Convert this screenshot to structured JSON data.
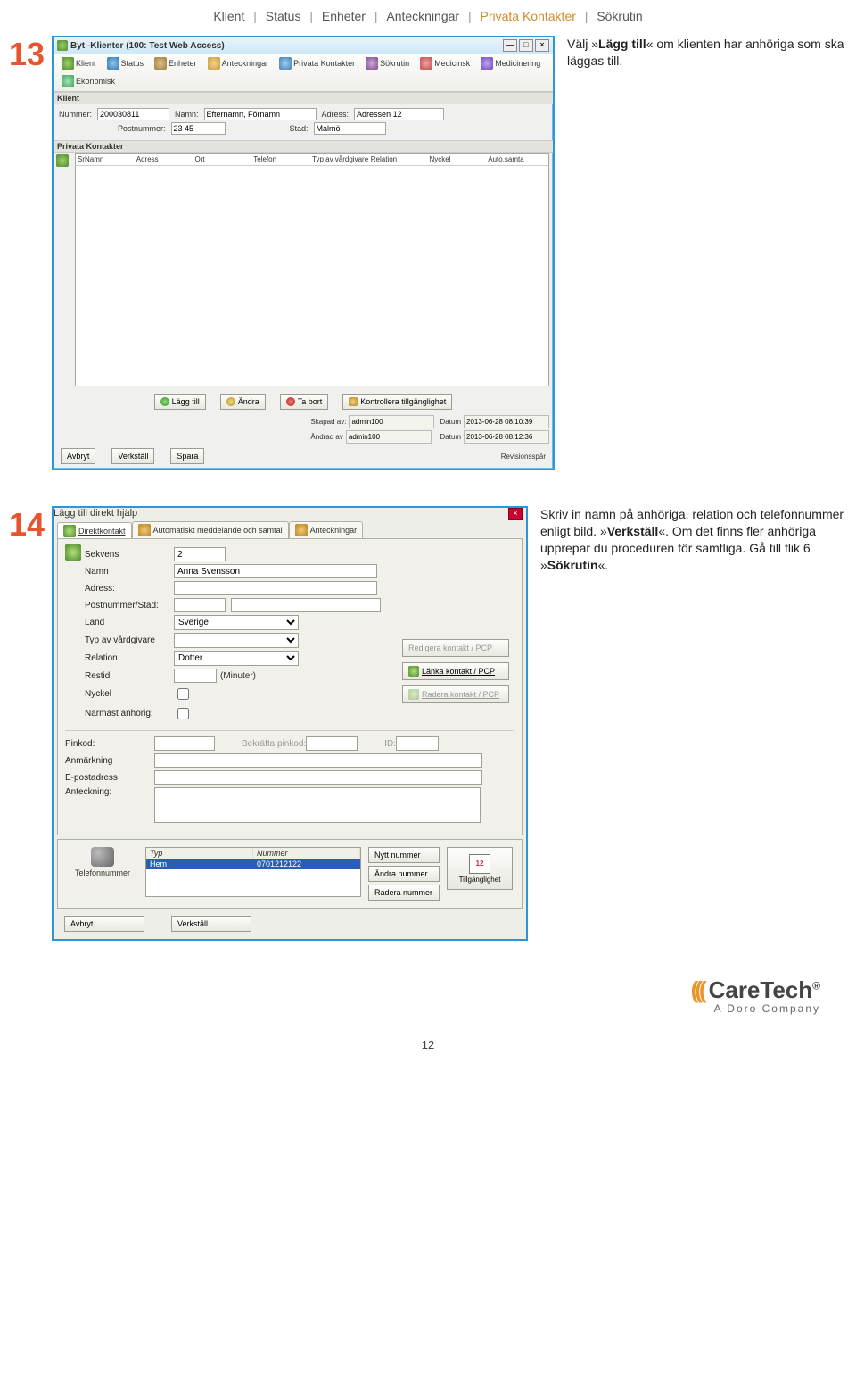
{
  "breadcrumb": {
    "items": [
      "Klient",
      "Status",
      "Enheter",
      "Anteckningar",
      "Privata Kontakter",
      "Sökrutin"
    ],
    "active_index": 4
  },
  "step13": {
    "number": "13",
    "window_title": "Byt -Klienter (100: Test Web Access)",
    "toolbar": [
      {
        "icon": "ico-user",
        "label": "Klient"
      },
      {
        "icon": "ico-blue",
        "label": "Status"
      },
      {
        "icon": "ico-box",
        "label": "Enheter"
      },
      {
        "icon": "ico-note",
        "label": "Anteckningar"
      },
      {
        "icon": "ico-person",
        "label": "Privata Kontakter"
      },
      {
        "icon": "ico-search",
        "label": "Sökrutin"
      },
      {
        "icon": "ico-med",
        "label": "Medicinsk"
      },
      {
        "icon": "ico-pill",
        "label": "Medicinering"
      },
      {
        "icon": "ico-econ",
        "label": "Ekonomisk"
      }
    ],
    "klient_header": "Klient",
    "klient": {
      "nummer_label": "Nummer:",
      "nummer": "200030811",
      "namn_label": "Namn:",
      "namn": "Efternamn, Förnamn",
      "adress_label": "Adress:",
      "adress": "Adressen 12",
      "postnr_label": "Postnummer:",
      "postnr": "23 45",
      "stad_label": "Stad:",
      "stad": "Malmö"
    },
    "pk_header": "Privata Kontakter",
    "pk_cols": [
      "SrNamn",
      "Adress",
      "Ort",
      "Telefon",
      "Typ av vårdgivare",
      "Relation",
      "Nyckel",
      "Auto.samta"
    ],
    "buttons": {
      "lagg_till": "Lägg till",
      "andra": "Ändra",
      "ta_bort": "Ta bort",
      "kontrollera": "Kontrollera tillgänglighet"
    },
    "meta": {
      "skapad_av_lbl": "Skapad av:",
      "skapad_av": "admin100",
      "skapad_datum_lbl": "Datum",
      "skapad_datum": "2013-06-28 08:10:39",
      "andrad_av_lbl": "Ändrad av",
      "andrad_av": "admin100",
      "andrad_datum_lbl": "Datum",
      "andrad_datum": "2013-06-28 08:12:36"
    },
    "bottom": {
      "avbryt": "Avbryt",
      "verkstall": "Verkställ",
      "spara": "Spara",
      "revision": "Revisionsspår"
    },
    "explanation_pre": "Välj »",
    "explanation_bold": "Lägg till",
    "explanation_post": "« om klienten har anhöriga som ska läggas till."
  },
  "step14": {
    "number": "14",
    "dialog_title": "Lägg till direkt hjälp",
    "tabs": {
      "direkt": "Direktkontakt",
      "auto": "Automatiskt meddelande och samtal",
      "anteckningar": "Anteckningar"
    },
    "fields": {
      "sekvens_lbl": "Sekvens",
      "sekvens": "2",
      "namn_lbl": "Namn",
      "namn": "Anna Svensson",
      "adress_lbl": "Adress:",
      "post_lbl": "Postnummer/Stad:",
      "land_lbl": "Land",
      "land": "Sverige",
      "typ_lbl": "Typ av vårdgivare",
      "relation_lbl": "Relation",
      "relation": "Dotter",
      "restid_lbl": "Restid",
      "restid_unit": "(Minuter)",
      "nyckel_lbl": "Nyckel",
      "narmast_lbl": "Närmast anhörig:"
    },
    "pcp_buttons": {
      "redigera": "Redigera kontakt / PCP",
      "lanka": "Länka kontakt / PCP",
      "radera": "Radera kontakt / PCP"
    },
    "lower": {
      "pinkod": "Pinkod:",
      "bekrafta": "Bekräfta pinkod:",
      "id": "ID:",
      "anmarkning": "Anmärkning",
      "epost": "E-postadress",
      "anteckning": "Anteckning:"
    },
    "phone": {
      "label": "Telefonnummer",
      "col_typ": "Typ",
      "col_nummer": "Nummer",
      "row_typ": "Hem",
      "row_nummer": "0701212122",
      "nytt": "Nytt nummer",
      "andra": "Ändra nummer",
      "radera": "Radera nummer",
      "tillg": "Tillgänglighet"
    },
    "bottom": {
      "avbryt": "Avbryt",
      "verkstall": "Verkställ"
    },
    "explanation": {
      "t1": "Skriv in namn på anhöriga, relation och telefonnummer enligt bild. »",
      "b1": "Verkställ",
      "t2": "«. Om det finns fler anhöriga upprepar du proceduren för samtliga. Gå till flik 6 »",
      "b2": "Sökrutin",
      "t3": "«."
    }
  },
  "footer": {
    "brand": "CareTech",
    "sub": "A Doro Company",
    "page": "12"
  }
}
